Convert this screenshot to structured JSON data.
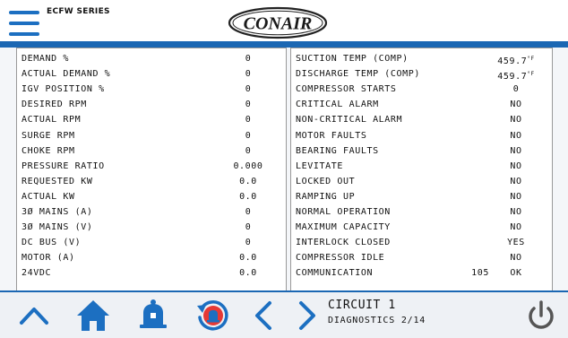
{
  "header": {
    "series": "ECFW SERIES",
    "logo_text": "CONAIR",
    "icons": {
      "menu": "hamburger-menu-icon",
      "logo": "conair-logo"
    }
  },
  "colors": {
    "accent": "#1b67b3",
    "icon_blue": "#1c6fc1",
    "alarm_red": "#e53935"
  },
  "left_panel": [
    {
      "label": "DEMAND %",
      "value": "0"
    },
    {
      "label": "ACTUAL DEMAND %",
      "value": "0"
    },
    {
      "label": "IGV POSITION %",
      "value": "0"
    },
    {
      "label": "DESIRED RPM",
      "value": "0"
    },
    {
      "label": "ACTUAL RPM",
      "value": "0"
    },
    {
      "label": "SURGE RPM",
      "value": "0"
    },
    {
      "label": "CHOKE RPM",
      "value": "0"
    },
    {
      "label": "PRESSURE RATIO",
      "value": "0.000"
    },
    {
      "label": "REQUESTED KW",
      "value": "0.0"
    },
    {
      "label": "ACTUAL KW",
      "value": "0.0"
    },
    {
      "label": "3Ø  MAINS (A)",
      "value": "0"
    },
    {
      "label": "3Ø  MAINS (V)",
      "value": "0"
    },
    {
      "label": "DC BUS (V)",
      "value": "0"
    },
    {
      "label": "MOTOR (A)",
      "value": "0.0"
    },
    {
      "label": "24VDC",
      "value": "0.0"
    }
  ],
  "right_panel": [
    {
      "label": "SUCTION TEMP (COMP)",
      "value": "459.7",
      "unit": "°F"
    },
    {
      "label": "DISCHARGE TEMP (COMP)",
      "value": "459.7",
      "unit": "°F"
    },
    {
      "label": "COMPRESSOR STARTS",
      "value": "0"
    },
    {
      "label": "CRITICAL ALARM",
      "value": "NO"
    },
    {
      "label": "NON-CRITICAL ALARM",
      "value": "NO"
    },
    {
      "label": "MOTOR FAULTS",
      "value": "NO"
    },
    {
      "label": "BEARING FAULTS",
      "value": "NO"
    },
    {
      "label": "LEVITATE",
      "value": "NO"
    },
    {
      "label": "LOCKED OUT",
      "value": "NO"
    },
    {
      "label": "RAMPING UP",
      "value": "NO"
    },
    {
      "label": "NORMAL OPERATION",
      "value": "NO"
    },
    {
      "label": "MAXIMUM CAPACITY",
      "value": "NO"
    },
    {
      "label": "INTERLOCK CLOSED",
      "value": "YES"
    },
    {
      "label": "COMPRESSOR IDLE",
      "value": "NO"
    },
    {
      "label": "COMMUNICATION",
      "extra": "105",
      "value": "OK"
    }
  ],
  "footer": {
    "circuit": "CIRCUIT 1",
    "page": "DIAGNOSTICS 2/14",
    "icons": [
      "chevron-up-icon",
      "home-icon",
      "alarm-bell-icon",
      "alarm-history-icon",
      "chevron-left-icon",
      "chevron-right-icon",
      "power-icon"
    ]
  }
}
